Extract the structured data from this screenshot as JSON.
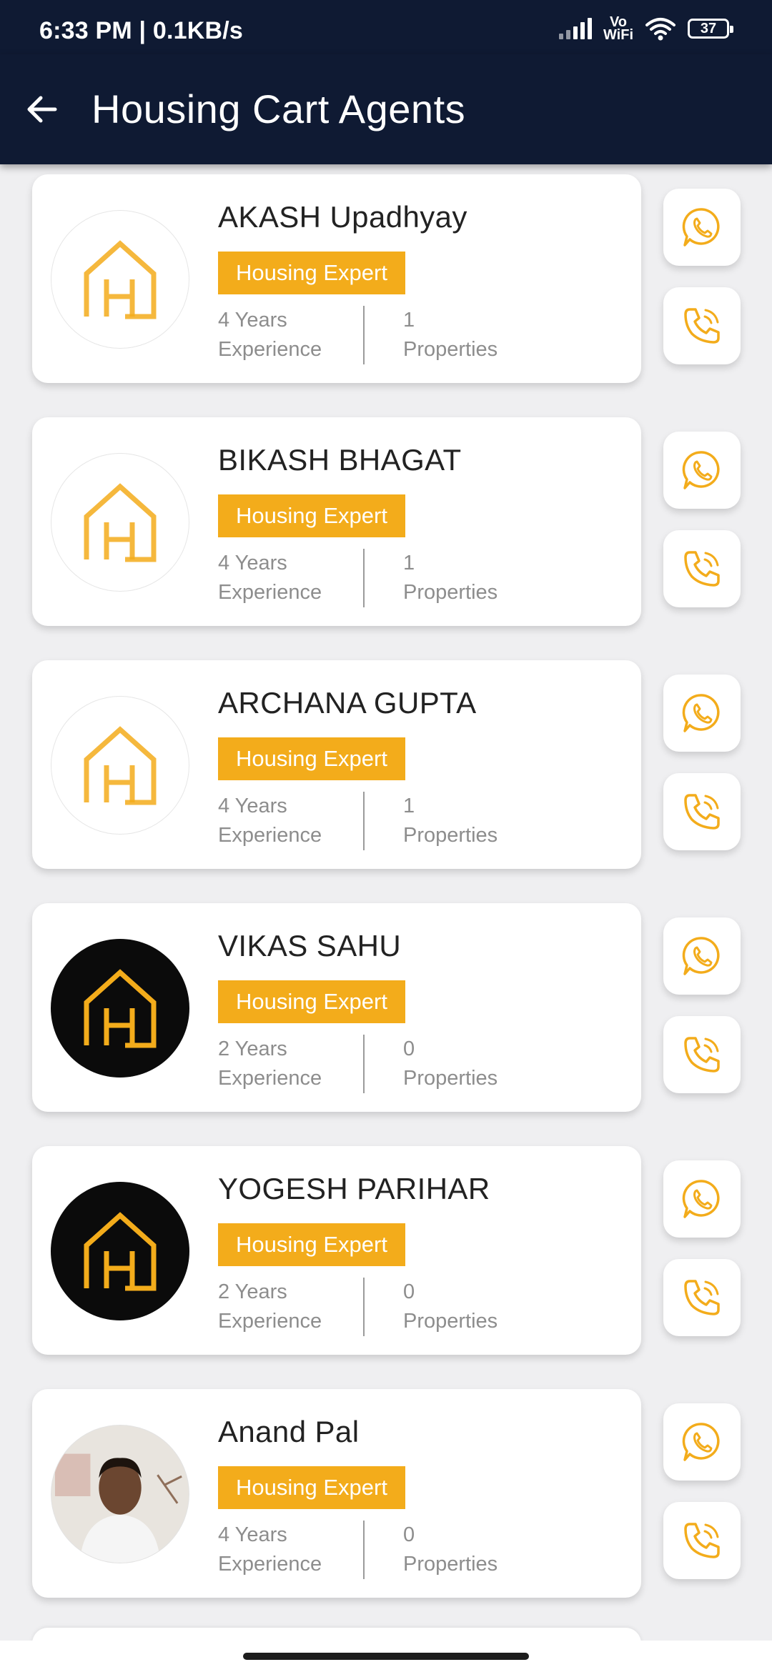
{
  "status_bar": {
    "time": "6:33 PM | 0.1KB/s",
    "vowifi_top": "Vo",
    "vowifi_bottom": "WiFi",
    "battery": "37"
  },
  "header": {
    "title": "Housing Cart Agents",
    "back_icon": "arrow-left-icon"
  },
  "colors": {
    "header_bg": "#0f1a33",
    "accent": "#f3ac1b",
    "background": "#efeff1"
  },
  "agents": [
    {
      "name": "AKASH Upadhyay",
      "badge": "Housing Expert",
      "years": "4 Years",
      "exp_label": "Experience",
      "properties": "1",
      "prop_label": "Properties",
      "avatar": "logo-light"
    },
    {
      "name": "BIKASH BHAGAT",
      "badge": "Housing Expert",
      "years": "4 Years",
      "exp_label": "Experience",
      "properties": "1",
      "prop_label": "Properties",
      "avatar": "logo-light"
    },
    {
      "name": "ARCHANA GUPTA",
      "badge": "Housing Expert",
      "years": "4 Years",
      "exp_label": "Experience",
      "properties": "1",
      "prop_label": "Properties",
      "avatar": "logo-light"
    },
    {
      "name": "VIKAS SAHU",
      "badge": "Housing Expert",
      "years": "2 Years",
      "exp_label": "Experience",
      "properties": "0",
      "prop_label": "Properties",
      "avatar": "logo-dark"
    },
    {
      "name": "YOGESH PARIHAR",
      "badge": "Housing Expert",
      "years": "2 Years",
      "exp_label": "Experience",
      "properties": "0",
      "prop_label": "Properties",
      "avatar": "logo-dark"
    },
    {
      "name": "Anand Pal",
      "badge": "Housing Expert",
      "years": "4 Years",
      "exp_label": "Experience",
      "properties": "0",
      "prop_label": "Properties",
      "avatar": "photo"
    }
  ],
  "actions": {
    "whatsapp_icon": "whatsapp-icon",
    "call_icon": "phone-call-icon"
  }
}
